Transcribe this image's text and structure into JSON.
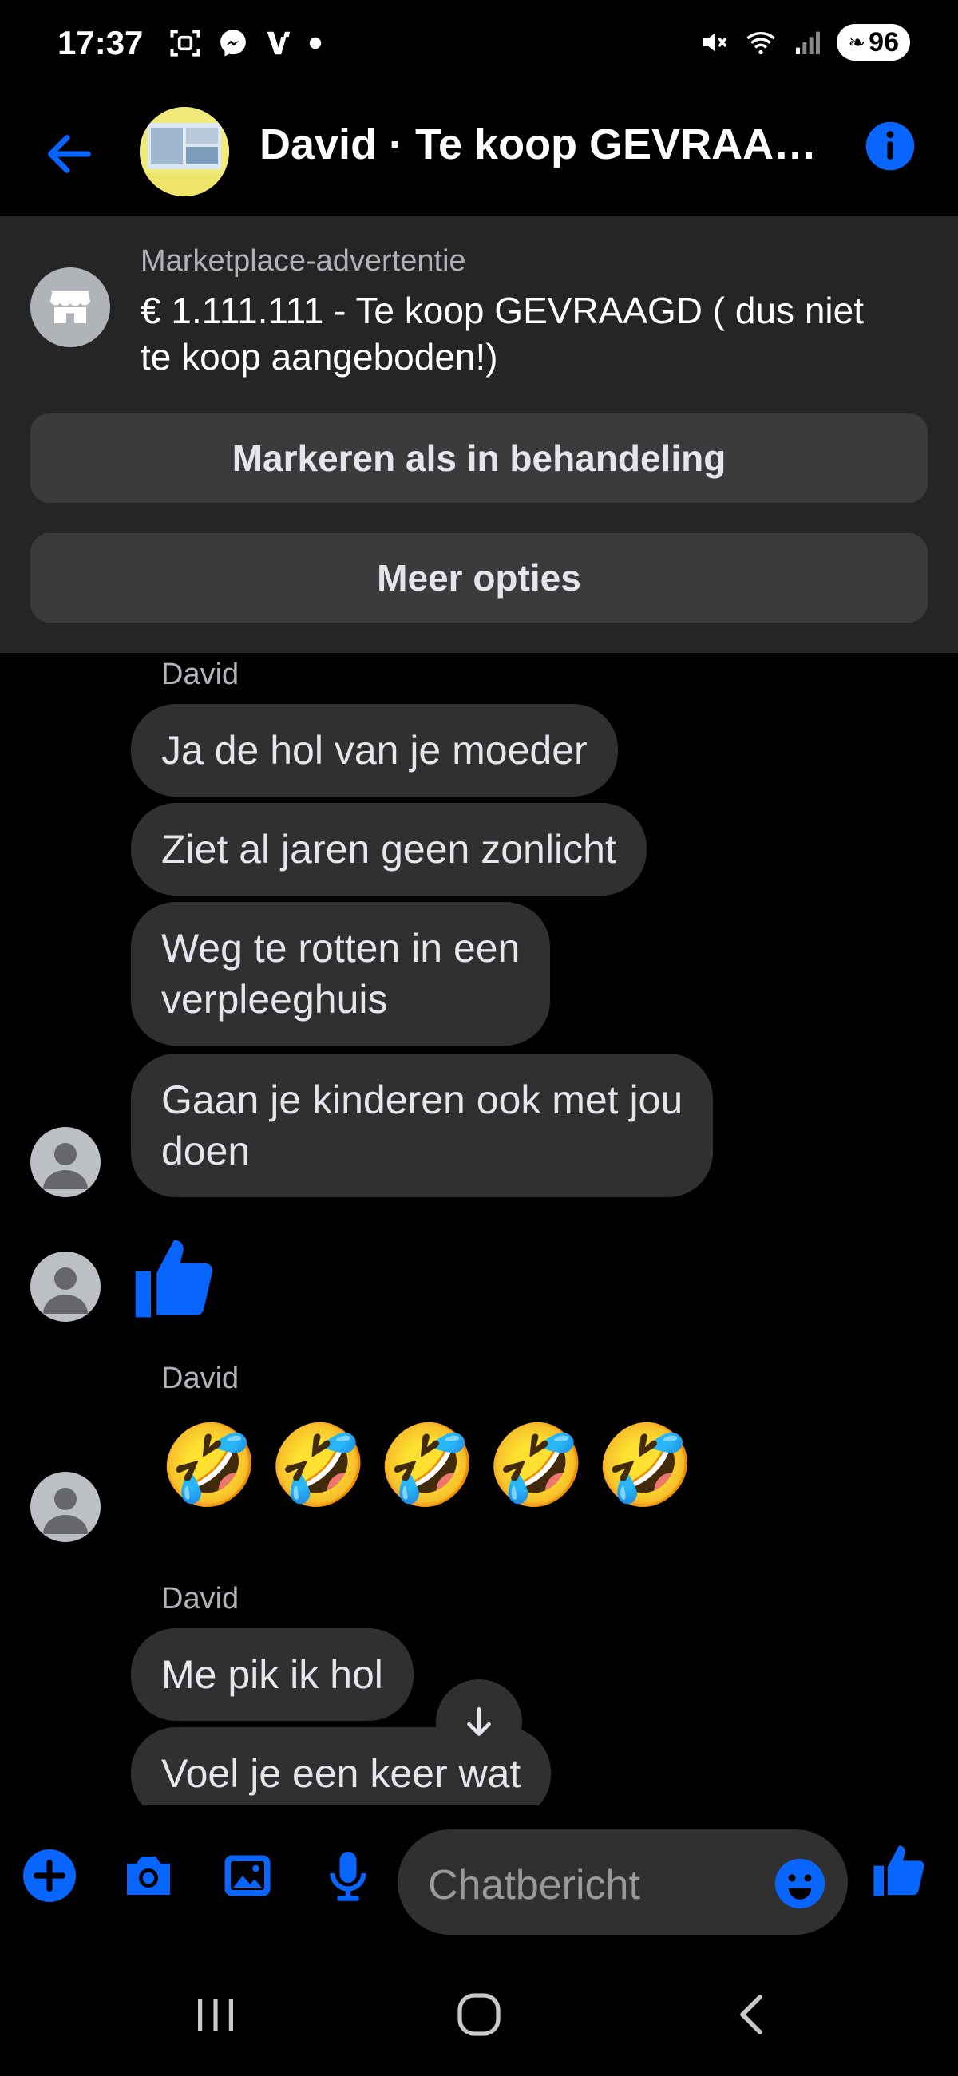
{
  "status_bar": {
    "time": "17:37",
    "battery": "96"
  },
  "header": {
    "title": "David · Te koop GEVRAAGD ( dus niet te koop aangeboden!)"
  },
  "marketplace": {
    "kicker": "Marketplace-advertentie",
    "title": "€ 1.111.111 - Te koop GEVRAAGD ( dus niet te koop aangeboden!)",
    "mark_button": "Markeren als in behandeling",
    "more_button": "Meer opties"
  },
  "messages": {
    "group1_sender": "David",
    "m1": "Ja de hol van je moeder",
    "m2": "Ziet al jaren geen zonlicht",
    "m3a": "Weg te rotten in een",
    "m3b": "verpleeghuis",
    "m4a": "Gaan je kinderen ook met jou",
    "m4b": "doen",
    "group2_sender": "David",
    "laugh_emojis": [
      "🤣",
      "🤣",
      "🤣",
      "🤣",
      "🤣"
    ],
    "group3_sender": "David",
    "m5": "Me pik ik hol",
    "m6": "Voel je een keer wat"
  },
  "composer": {
    "placeholder": "Chatbericht"
  },
  "colors": {
    "accent": "#0866ff",
    "bubble": "#303030",
    "panel": "#242526",
    "panel_button": "#3a3b3c"
  }
}
